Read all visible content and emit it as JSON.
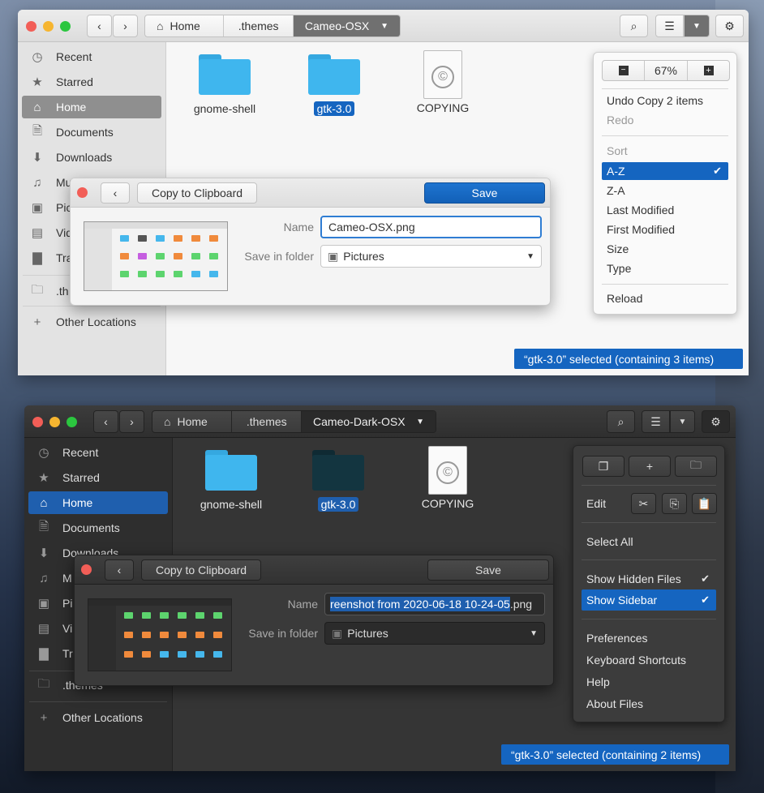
{
  "light": {
    "crumbs": [
      "Home",
      ".themes",
      "Cameo-OSX"
    ],
    "sidebar": [
      "Recent",
      "Starred",
      "Home",
      "Documents",
      "Downloads",
      "Mu",
      "Pic",
      "Vid",
      "Tra",
      ".th",
      "Other Locations"
    ],
    "files": [
      "gnome-shell",
      "gtk-3.0",
      "COPYING"
    ],
    "status": "“gtk-3.0” selected  (containing 3 items)",
    "menu": {
      "zoom": "67%",
      "undo": "Undo Copy 2 items",
      "redo": "Redo",
      "sort_heading": "Sort",
      "sort_items": [
        "A-Z",
        "Z-A",
        "Last Modified",
        "First Modified",
        "Size",
        "Type"
      ],
      "reload": "Reload"
    },
    "dialog": {
      "title": "Copy to Clipboard",
      "save": "Save",
      "name_label": "Name",
      "name_value": "Cameo-OSX.png",
      "folder_label": "Save in folder",
      "folder_value": "Pictures"
    }
  },
  "dark": {
    "crumbs": [
      "Home",
      ".themes",
      "Cameo-Dark-OSX"
    ],
    "sidebar": [
      "Recent",
      "Starred",
      "Home",
      "Documents",
      "Downloads",
      "M",
      "Pi",
      "Vi",
      "Tr",
      ".themes",
      "Other Locations"
    ],
    "files": [
      "gnome-shell",
      "gtk-3.0",
      "COPYING"
    ],
    "status": "“gtk-3.0” selected  (containing 2 items)",
    "menu": {
      "edit": "Edit",
      "select_all": "Select All",
      "show_hidden": "Show Hidden Files",
      "show_sidebar": "Show Sidebar",
      "preferences": "Preferences",
      "shortcuts": "Keyboard Shortcuts",
      "help": "Help",
      "about": "About Files"
    },
    "dialog": {
      "title": "Copy to Clipboard",
      "save": "Save",
      "name_label": "Name",
      "name_value": "reenshot from 2020-06-18 10-24-05",
      "name_suffix": ".png",
      "folder_label": "Save in folder",
      "folder_value": "Pictures"
    }
  },
  "colors": {
    "accent": "#1565c0",
    "folder_light": "#3fb6ee",
    "folder_dark_selected": "#133540",
    "traffic_red": "#f25e57",
    "traffic_yellow": "#f6b530",
    "traffic_green": "#2bc63f"
  },
  "icons": [
    "back-icon",
    "forward-icon",
    "home-icon",
    "search-icon",
    "list-view-icon",
    "chevron-down-icon",
    "gear-icon",
    "clock-icon",
    "star-icon",
    "document-icon",
    "download-icon",
    "music-icon",
    "camera-icon",
    "film-icon",
    "trash-icon",
    "folder-icon",
    "plus-icon",
    "cut-icon",
    "copy-icon",
    "paste-icon",
    "new-window-icon",
    "new-folder-icon",
    "check-icon",
    "minus-icon"
  ]
}
